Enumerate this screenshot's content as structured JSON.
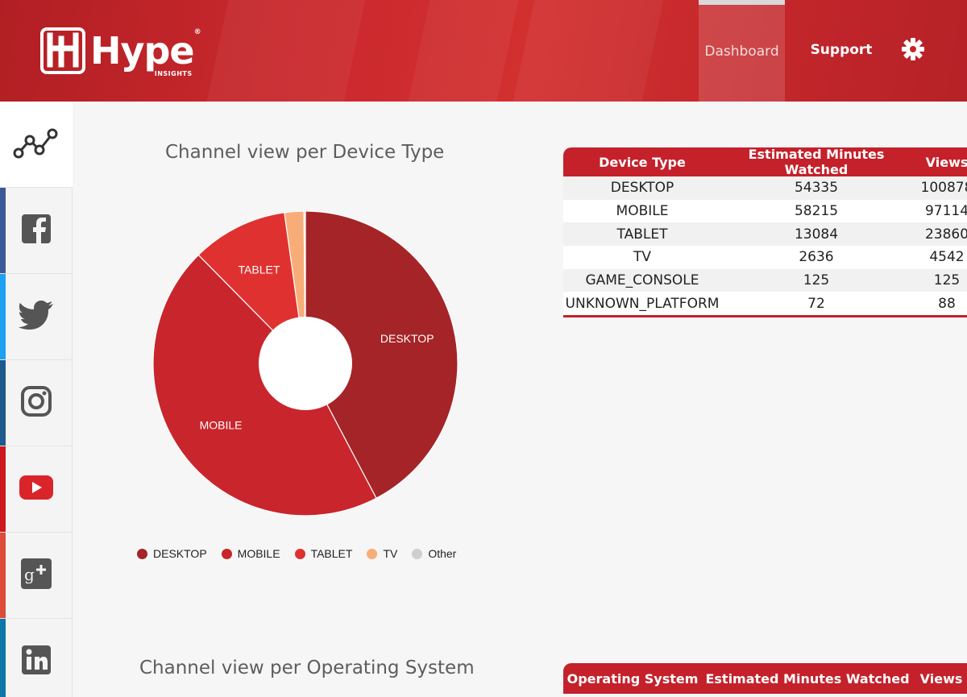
{
  "header": {
    "logo_text": "Hype",
    "logo_subtext": "INSIGHTS",
    "logo_reg": "®",
    "nav": {
      "dashboard_label": "Dashboard",
      "support_label": "Support",
      "settings_icon": "gear-icon"
    },
    "colors": {
      "brand_red": "#c4212b"
    }
  },
  "sidebar": {
    "items": [
      {
        "icon": "analytics-icon",
        "active": true
      },
      {
        "icon": "facebook-icon",
        "stripe": "#3b5998"
      },
      {
        "icon": "twitter-icon",
        "stripe": "#1da1f2"
      },
      {
        "icon": "instagram-icon",
        "stripe": "#1e5b8c"
      },
      {
        "icon": "youtube-icon",
        "stripe": "#cc181e"
      },
      {
        "icon": "google-plus-icon",
        "stripe": "#dd4b39"
      },
      {
        "icon": "linkedin-icon",
        "stripe": "#0e76a8"
      }
    ]
  },
  "device_section": {
    "title": "Channel view per Device Type"
  },
  "chart_data": {
    "type": "pie",
    "title": "Channel view per Device Type",
    "donut": true,
    "labels": [
      "DESKTOP",
      "MOBILE",
      "TABLET",
      "TV",
      "Other"
    ],
    "values": [
      54335,
      58215,
      13084,
      2636,
      197
    ],
    "colors": [
      "#a52427",
      "#c9252c",
      "#e03131",
      "#f8ad78",
      "#cfcfcf"
    ],
    "slice_labels": [
      "DESKTOP",
      "MOBILE",
      "TABLET",
      "",
      ""
    ],
    "legend": [
      "DESKTOP",
      "MOBILE",
      "TABLET",
      "TV",
      "Other"
    ],
    "legend_position": "bottom"
  },
  "device_table": {
    "headers": [
      "Device Type",
      "Estimated Minutes Watched",
      "Views"
    ],
    "rows": [
      [
        "DESKTOP",
        "54335",
        "100878"
      ],
      [
        "MOBILE",
        "58215",
        "97114"
      ],
      [
        "TABLET",
        "13084",
        "23860"
      ],
      [
        "TV",
        "2636",
        "4542"
      ],
      [
        "GAME_CONSOLE",
        "125",
        "125"
      ],
      [
        "UNKNOWN_PLATFORM",
        "72",
        "88"
      ]
    ]
  },
  "os_section": {
    "title": "Channel view per Operating System"
  },
  "os_table": {
    "headers": [
      "Operating System",
      "Estimated Minutes Watched",
      "Views"
    ]
  }
}
